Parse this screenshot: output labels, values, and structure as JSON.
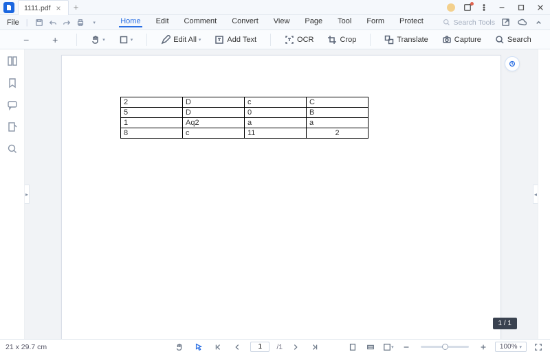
{
  "titlebar": {
    "tab_name": "1111.pdf"
  },
  "menubar": {
    "file": "File",
    "items": [
      "Home",
      "Edit",
      "Comment",
      "Convert",
      "View",
      "Page",
      "Tool",
      "Form",
      "Protect"
    ],
    "active_index": 0,
    "search_tools_placeholder": "Search Tools"
  },
  "toolbar": {
    "edit_all": "Edit All",
    "add_text": "Add Text",
    "ocr": "OCR",
    "crop": "Crop",
    "translate": "Translate",
    "capture": "Capture",
    "search": "Search"
  },
  "document": {
    "table": {
      "rows": [
        [
          "2",
          "D",
          "c",
          "C"
        ],
        [
          "5",
          "D",
          "0",
          "B"
        ],
        [
          "1",
          "Aq2",
          "a",
          "a"
        ],
        [
          "8",
          "c",
          "11",
          "2"
        ]
      ],
      "last_row_last_cell_centered": true
    }
  },
  "page_indicator": "1 / 1",
  "statusbar": {
    "dimensions": "21 x 29.7 cm",
    "current_page": "1",
    "total_pages": "/1",
    "zoom": "100%"
  }
}
